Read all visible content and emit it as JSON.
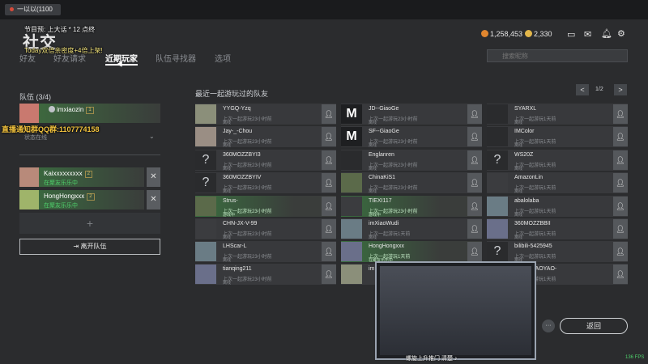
{
  "stream": {
    "title": "一以以(1100",
    "overlay_line1": "节目预: 上大话 * 12 点终",
    "overlay_line2": "Today双倍亲密度+4倍上架!",
    "big_glyph": "社交",
    "qq_banner": "直播通知群QQ群:1107774158"
  },
  "header": {
    "tabs": [
      {
        "label": "好友",
        "active": false
      },
      {
        "label": "好友请求",
        "active": false
      },
      {
        "label": "近期玩家",
        "active": true
      },
      {
        "label": "队伍寻找器",
        "active": false
      },
      {
        "label": "选项",
        "active": false
      }
    ],
    "search_placeholder": "搜索昵称",
    "currency1": "1,258,453",
    "currency2": "2,330",
    "icons": [
      "monitor-icon",
      "mail-icon",
      "bell-icon",
      "gear-icon"
    ]
  },
  "party": {
    "title": "队伍 (3/4)",
    "leader": {
      "name": "imxiaozin",
      "badge": "1",
      "status": "状态在线"
    },
    "members": [
      {
        "name": "Kaixxxxxxxxx",
        "badge": "2",
        "status": "在聚友乐乐中"
      },
      {
        "name": "HongHongxxx",
        "badge": "2",
        "status": "在聚友乐乐中"
      }
    ],
    "add_slot": "+",
    "leave_label": "离开队伍"
  },
  "recent": {
    "title": "最近一起游玩过的队友",
    "page": "1/2",
    "prev": "<",
    "next": ">",
    "columns": [
      [
        {
          "name": "YYGQ-Yzq",
          "sub": "上次一起游玩23小时前",
          "sub2": "离线"
        },
        {
          "name": "Jay-_-Chou",
          "sub": "上次一起游玩23小时前",
          "sub2": "离线"
        },
        {
          "name": "360MOZZBYI3",
          "sub": "上次一起游玩23小时前",
          "sub2": "离线"
        },
        {
          "name": "360MOZZBYIV",
          "sub": "上次一起游玩23小时前",
          "sub2": "离线"
        },
        {
          "name": "Strus-",
          "sub": "上次一起游玩23小时前",
          "sub2": "游戏中"
        },
        {
          "name": "CHN-JX-V-99",
          "sub": "上次一起游玩23小时前",
          "sub2": "离线"
        },
        {
          "name": "LHScar-L",
          "sub": "上次一起游玩23小时前",
          "sub2": "离线"
        },
        {
          "name": "tianqing211",
          "sub": "上次一起游玩23小时前",
          "sub2": "离线"
        }
      ],
      [
        {
          "name": "JD--GiaoGe",
          "sub": "上次一起游玩23小时前",
          "sub2": "离线"
        },
        {
          "name": "SF--GiaoGe",
          "sub": "上次一起游玩23小时前",
          "sub2": "离线"
        },
        {
          "name": "Englanren",
          "sub": "上次一起游玩23小时前",
          "sub2": "离线"
        },
        {
          "name": "ChinaKiS1",
          "sub": "上次一起游玩23小时前",
          "sub2": "离线"
        },
        {
          "name": "TIEXI117",
          "sub": "上次一起游玩23小时前",
          "sub2": "游戏中"
        },
        {
          "name": "imXiaoWudi",
          "sub": "上次一起游玩1天前",
          "sub2": "离线"
        },
        {
          "name": "HongHongxxx",
          "sub": "上次一起游玩1天前",
          "sub2": "在聚友乐乐中"
        },
        {
          "name": "im",
          "sub": "",
          "sub2": ""
        }
      ],
      [
        {
          "name": "SYARXL",
          "sub": "上次一起游玩1天前",
          "sub2": "离线"
        },
        {
          "name": "IMColor",
          "sub": "上次一起游玩1天前",
          "sub2": "离线"
        },
        {
          "name": "WS20Z",
          "sub": "上次一起游玩1天前",
          "sub2": "离线"
        },
        {
          "name": "AmazonLin",
          "sub": "上次一起游玩1天前",
          "sub2": "离线"
        },
        {
          "name": "abalolaba",
          "sub": "上次一起游玩1天前",
          "sub2": "离线"
        },
        {
          "name": "360MOZZBBII",
          "sub": "上次一起游玩1天前",
          "sub2": "离线"
        },
        {
          "name": "bilibili-5425945",
          "sub": "上次一起游玩1天前",
          "sub2": "离线"
        },
        {
          "name": "IYUANYAOYAO-",
          "sub": "上次一起游玩1天前",
          "sub2": "离线"
        }
      ]
    ]
  },
  "webcam_caption": "螺旋上升推门 清楚 ♪",
  "back_label": "返回",
  "chat_label": "···",
  "fps": "136 FPS",
  "colors": {
    "accent_green": "#4fcf6b",
    "gold": "#f3c33e",
    "background": "#2b2c2e"
  }
}
